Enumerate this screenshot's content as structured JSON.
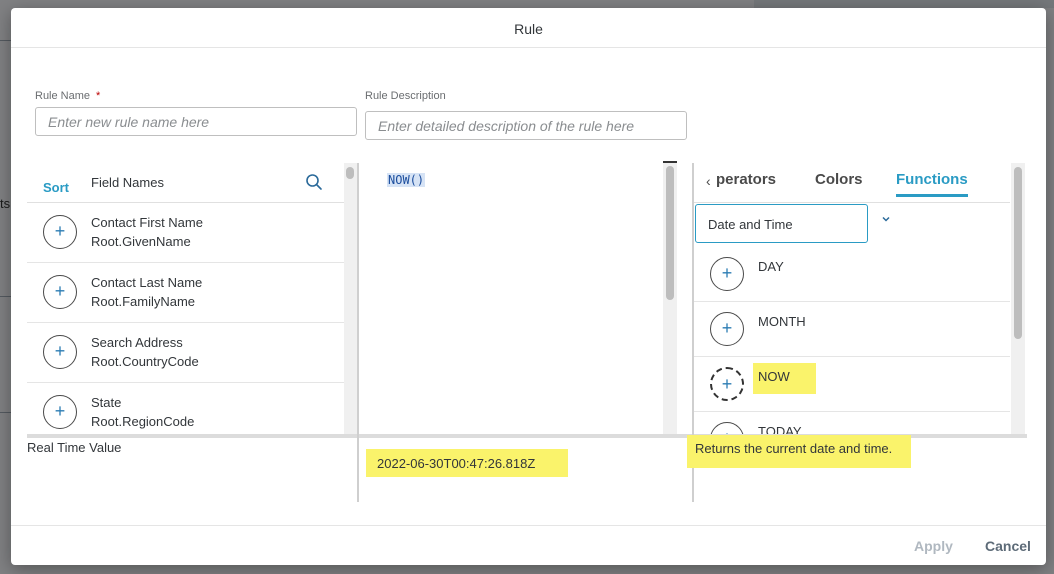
{
  "dialog": {
    "title": "Rule"
  },
  "form": {
    "rule_name_label": "Rule Name",
    "required_mark": "*",
    "rule_name_placeholder": "Enter new rule name here",
    "rule_desc_label": "Rule Description",
    "rule_desc_placeholder": "Enter detailed description of the rule here"
  },
  "fields_panel": {
    "sort_label": "Sort",
    "header": "Field Names",
    "items": [
      {
        "name": "Contact First Name",
        "path": "Root.GivenName"
      },
      {
        "name": "Contact Last Name",
        "path": "Root.FamilyName"
      },
      {
        "name": "Search Address",
        "path": "Root.CountryCode"
      },
      {
        "name": "State",
        "path": "Root.RegionCode"
      }
    ]
  },
  "editor": {
    "code": "NOW()"
  },
  "functions_panel": {
    "tabs": [
      "perators",
      "Colors",
      "Functions"
    ],
    "active_tab": "Functions",
    "category": "Date and Time",
    "items": [
      "DAY",
      "MONTH",
      "NOW",
      "TODAY"
    ],
    "selected_item": "NOW",
    "description": "Returns the current date and time."
  },
  "real_time": {
    "label": "Real Time Value",
    "value": "2022-06-30T00:47:26.818Z"
  },
  "footer": {
    "apply": "Apply",
    "cancel": "Cancel"
  },
  "colors": {
    "accent": "#2a9bc4",
    "highlight": "#faf36b",
    "required": "#bb0000"
  },
  "icons": {
    "search": "search-icon",
    "add": "plus-circle-icon",
    "tab_back": "chevron-left-icon",
    "dropdown": "chevron-down-icon"
  }
}
